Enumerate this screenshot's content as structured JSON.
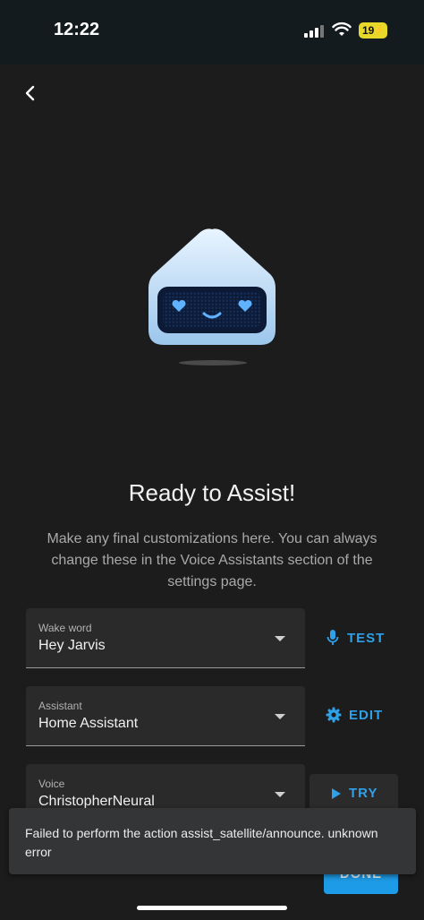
{
  "status_bar": {
    "time": "12:22",
    "battery": "19"
  },
  "header": {
    "back_icon": "chevron-left-icon"
  },
  "content": {
    "illustration": "assist-robot-heart-eyes",
    "title": "Ready to Assist!",
    "subtitle": "Make any final customizations here. You can always change these in the Voice Assistants section of the settings page."
  },
  "wake_word": {
    "label": "Wake word",
    "value": "Hey Jarvis",
    "action": "TEST",
    "action_icon": "microphone-icon"
  },
  "assistant": {
    "label": "Assistant",
    "value": "Home Assistant",
    "action": "EDIT",
    "action_icon": "gear-icon"
  },
  "voice": {
    "label": "Voice",
    "value": "ChristopherNeural",
    "action": "TRY",
    "action_icon": "play-icon"
  },
  "done_button": "DONE",
  "snackbar": {
    "message": "Failed to perform the action assist_satellite/announce. unknown error"
  },
  "colors": {
    "accent": "#2ea1e8",
    "background": "#1c1c1c",
    "field": "#2a2a2a",
    "status_bar": "#141b1f"
  }
}
